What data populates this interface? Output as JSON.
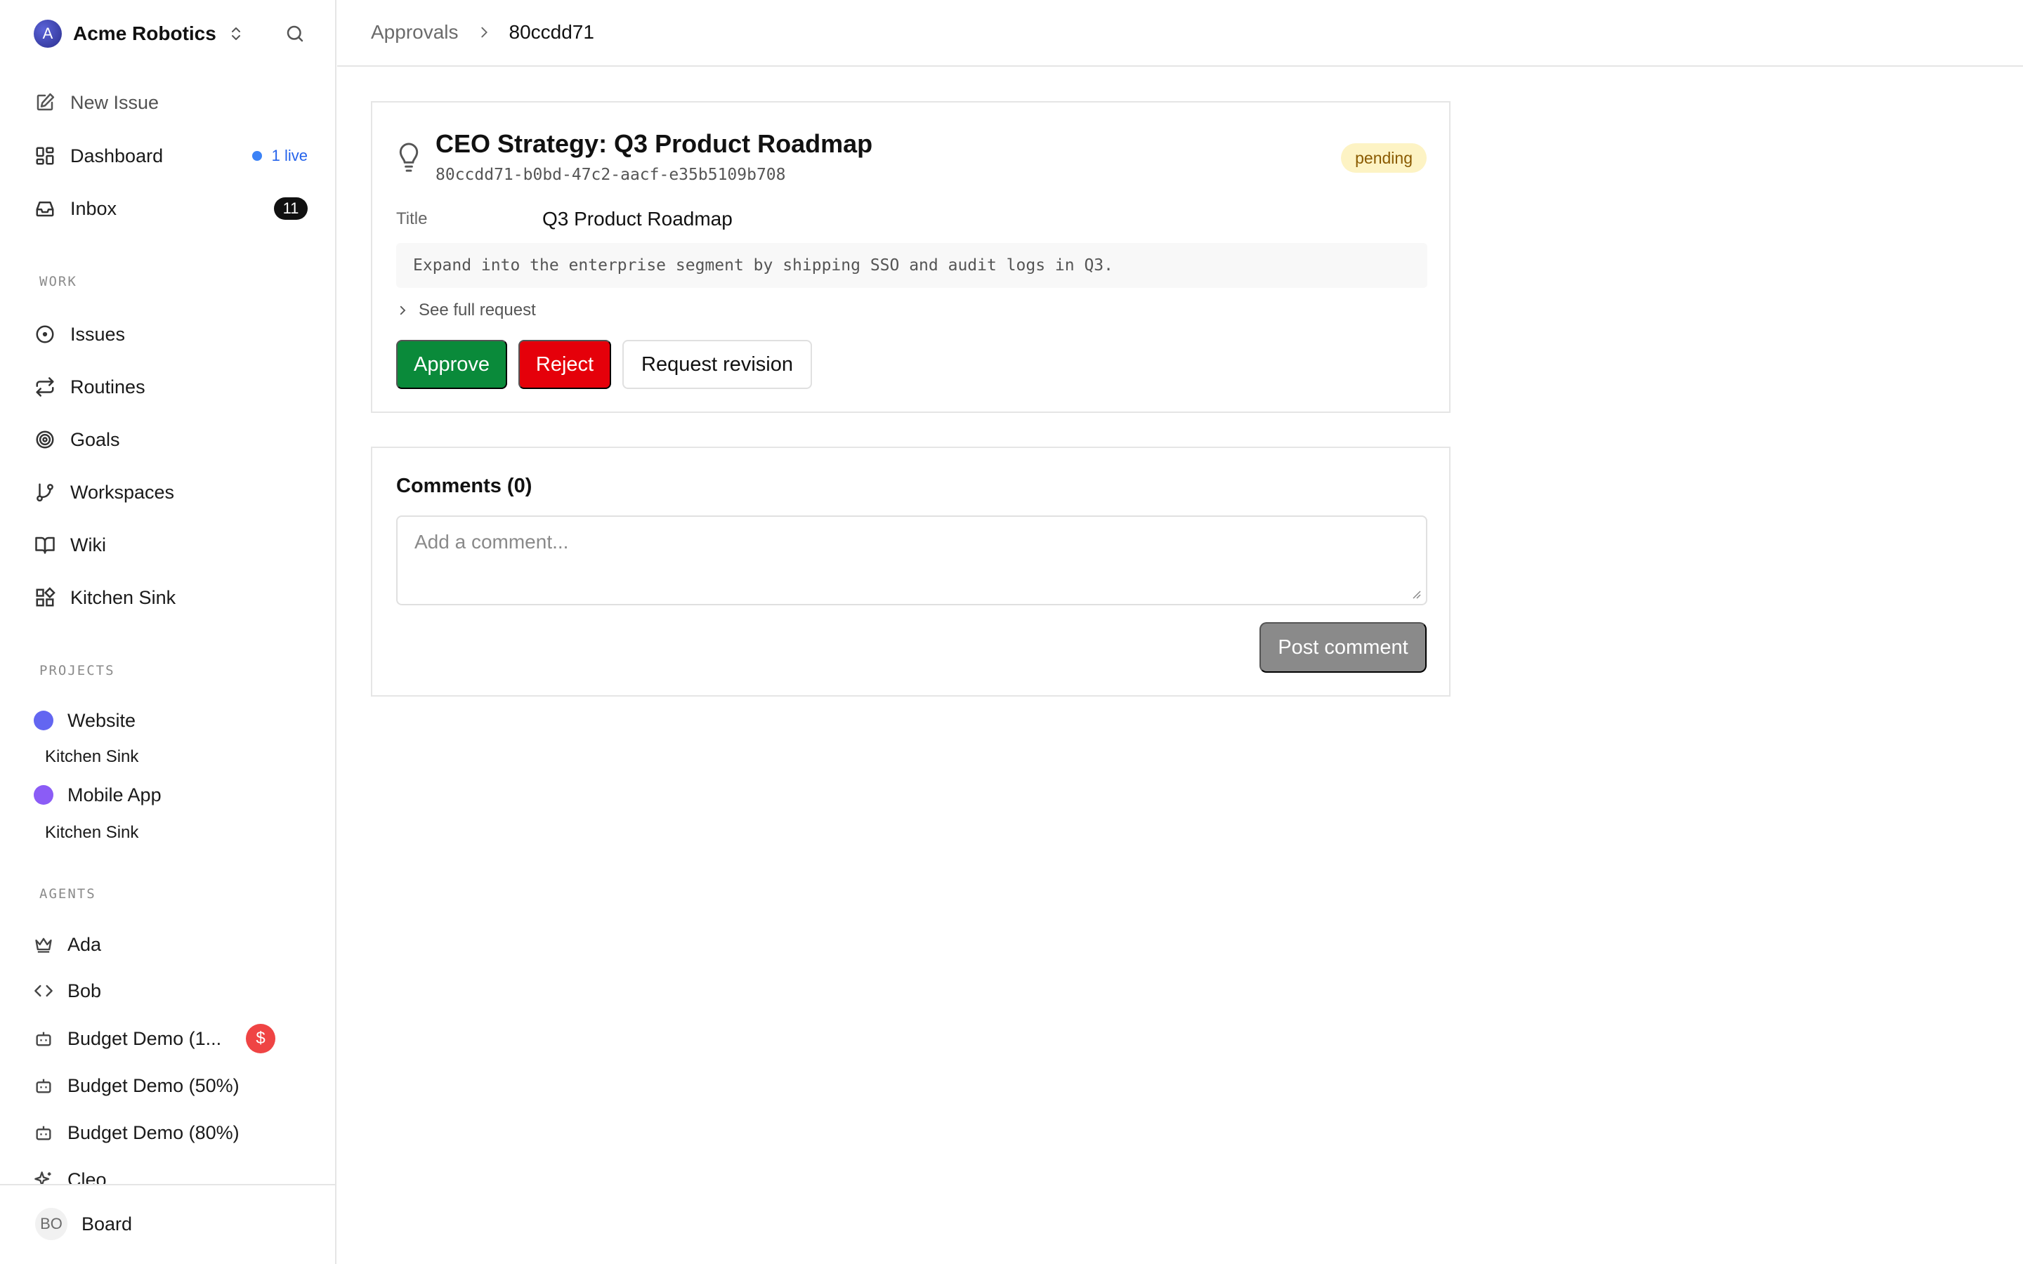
{
  "sidebar": {
    "company": {
      "logo_letter": "A",
      "name": "Acme Robotics"
    },
    "nav": {
      "new_issue": "New Issue",
      "dashboard": "Dashboard",
      "dashboard_live": "1 live",
      "inbox": "Inbox",
      "inbox_count": "11"
    },
    "work_label": "WORK",
    "work_items": [
      "Issues",
      "Routines",
      "Goals",
      "Workspaces",
      "Wiki",
      "Kitchen Sink"
    ],
    "projects_label": "PROJECTS",
    "projects": [
      {
        "name": "Website",
        "color": "#6366f1",
        "sub": "Kitchen Sink"
      },
      {
        "name": "Mobile App",
        "color": "#8b5cf6",
        "sub": "Kitchen Sink"
      }
    ],
    "agents_label": "AGENTS",
    "agents": [
      {
        "name": "Ada",
        "icon": "crown-icon"
      },
      {
        "name": "Bob",
        "icon": "code-icon"
      },
      {
        "name": "Budget Demo (1...",
        "icon": "bot-icon",
        "badge": "$"
      },
      {
        "name": "Budget Demo (50%)",
        "icon": "bot-icon"
      },
      {
        "name": "Budget Demo (80%)",
        "icon": "bot-icon"
      },
      {
        "name": "Cleo",
        "icon": "sparkle-icon"
      }
    ],
    "footer": {
      "avatar": "BO",
      "label": "Board"
    }
  },
  "breadcrumb": {
    "parent": "Approvals",
    "current": "80ccdd71"
  },
  "approval": {
    "title": "CEO Strategy: Q3 Product Roadmap",
    "id": "80ccdd71-b0bd-47c2-aacf-e35b5109b708",
    "status": "pending",
    "field_label": "Title",
    "field_value": "Q3 Product Roadmap",
    "summary": "Expand into the enterprise segment by shipping SSO and audit logs in Q3.",
    "see_full": "See full request",
    "approve": "Approve",
    "reject": "Reject",
    "request_revision": "Request revision"
  },
  "comments": {
    "title": "Comments (0)",
    "placeholder": "Add a comment...",
    "post": "Post comment"
  },
  "colors": {
    "approve": "#0a8a3a",
    "reject": "#e5000a",
    "pending_bg": "#fdf3c4",
    "live": "#2563eb",
    "budget_badge": "#ef4444"
  }
}
